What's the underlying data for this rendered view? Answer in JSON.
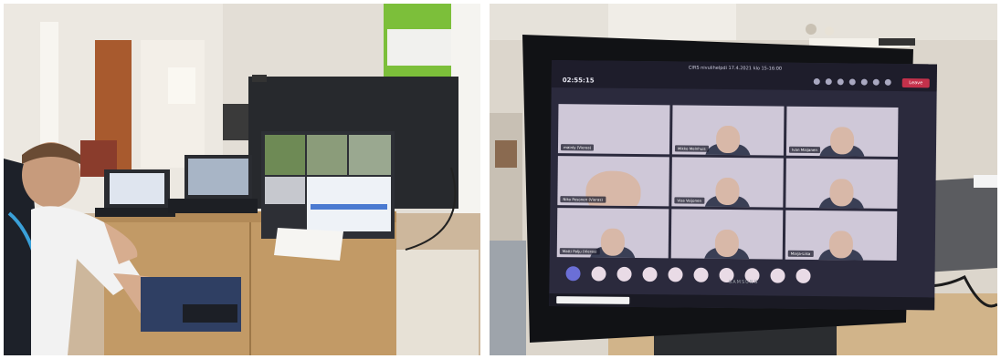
{
  "photos": [
    {
      "id": "left",
      "scene": "streaming-desk",
      "poster_brand_color": "#7cbf3a"
    },
    {
      "id": "right",
      "scene": "tv-video-meeting",
      "meeting": {
        "window_title": "CIRS nivulihelpdi 17.4.2021 klo 15-16:00",
        "timer": "02:55:15",
        "leave_label": "Leave",
        "participants": [
          {
            "name": "mainly (Vieras)"
          },
          {
            "name": "Mikko Melnhuis"
          },
          {
            "name": "Ivan Maijanen"
          },
          {
            "name": "Niko Pesonen (Vieras)"
          },
          {
            "name": "Visa Veijonen"
          },
          {
            "name": ""
          },
          {
            "name": "Matti Palju (Vieras)"
          },
          {
            "name": ""
          },
          {
            "name": "Marja-Liisa"
          }
        ],
        "dock_buttons": 10
      },
      "tv_brand": "SAMSUNG",
      "colors": {
        "teams_bg": "#2b2a3d",
        "leave": "#c4314b",
        "accent": "#6b6fd6"
      }
    }
  ]
}
